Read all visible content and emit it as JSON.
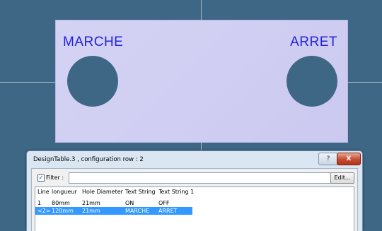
{
  "plate": {
    "left_label": "MARCHE",
    "right_label": "ARRET"
  },
  "dialog": {
    "title": "DesignTable.3 , configuration row : 2",
    "help_label": "?",
    "close_label": "X",
    "filter_label": "Filter :",
    "filter_checked": true,
    "filter_value": "",
    "edit_label": "Edit..."
  },
  "table": {
    "headers": [
      "Line",
      "longueur",
      "Hole Diameter",
      "Text String",
      "Text String 1"
    ],
    "rows": [
      [
        "1",
        "80mm",
        "21mm",
        "ON",
        "OFF"
      ],
      [
        "<2>",
        "120mm",
        "21mm",
        "MARCHE",
        "ARRET"
      ]
    ],
    "selected_row": 1
  },
  "colors": {
    "background": "#3e6786",
    "plate": "#d5d3f4",
    "label_text": "#2222dd",
    "selection": "#3399ff"
  }
}
